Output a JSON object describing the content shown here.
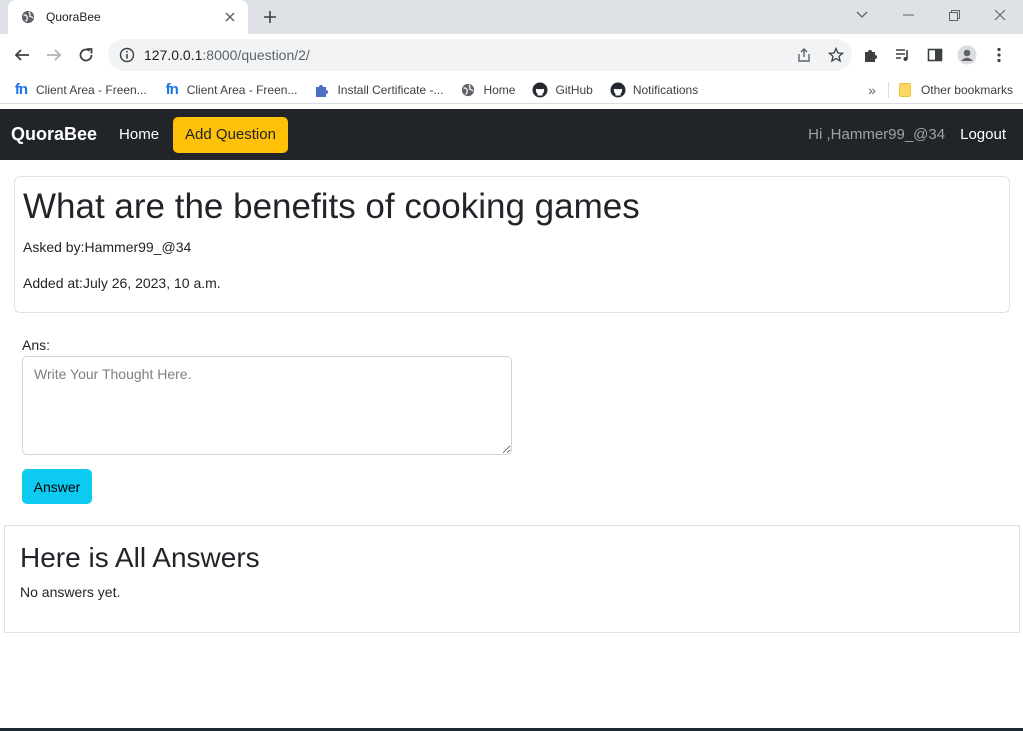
{
  "browser": {
    "tab_title": "QuoraBee",
    "url_host": "127.0.0.1",
    "url_path": ":8000/question/2/",
    "bookmarks": [
      {
        "label": "Client Area - Freen...",
        "icon": "freenom-icon"
      },
      {
        "label": "Client Area - Freen...",
        "icon": "freenom-icon"
      },
      {
        "label": "Install Certificate -...",
        "icon": "puzzle-icon"
      },
      {
        "label": "Home",
        "icon": "globe-icon"
      },
      {
        "label": "GitHub",
        "icon": "github-icon"
      },
      {
        "label": "Notifications",
        "icon": "github-icon"
      }
    ],
    "other_bookmarks": "Other bookmarks",
    "freenom_glyph": "fn"
  },
  "navbar": {
    "brand": "QuoraBee",
    "home": "Home",
    "add_question": "Add Question",
    "greeting": "Hi ,Hammer99_@34",
    "logout": "Logout"
  },
  "question": {
    "title": "What are the benefits of cooking games",
    "asked_by": "Asked by:Hammer99_@34",
    "added_at": "Added at:July 26, 2023, 10 a.m."
  },
  "answer_form": {
    "label": "Ans:",
    "placeholder": "Write Your Thought Here.",
    "submit": "Answer"
  },
  "answers": {
    "heading": "Here is All Answers",
    "empty_text": "No answers yet."
  },
  "colors": {
    "navbar_bg": "#212529",
    "add_question_bg": "#ffc107",
    "answer_button_bg": "#0dcaf0"
  }
}
